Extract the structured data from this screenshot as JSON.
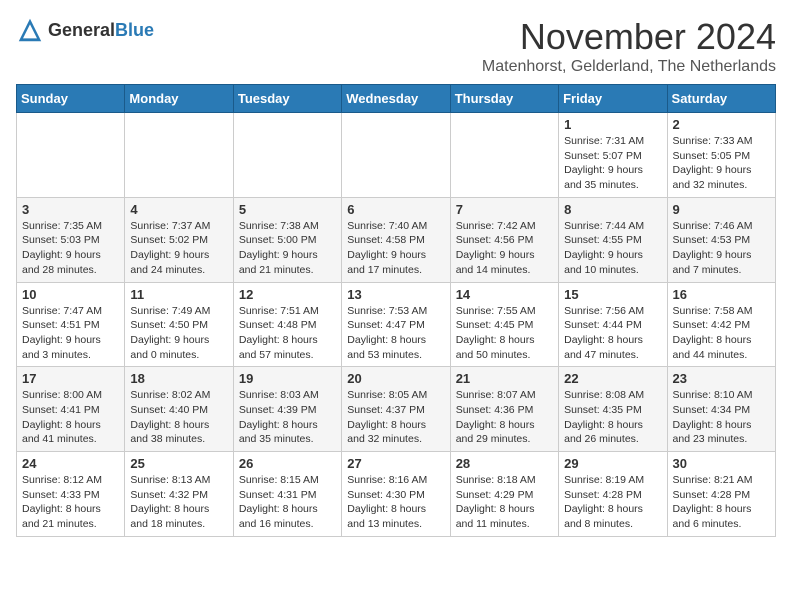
{
  "logo": {
    "text_general": "General",
    "text_blue": "Blue"
  },
  "header": {
    "month_title": "November 2024",
    "location": "Matenhorst, Gelderland, The Netherlands"
  },
  "days_of_week": [
    "Sunday",
    "Monday",
    "Tuesday",
    "Wednesday",
    "Thursday",
    "Friday",
    "Saturday"
  ],
  "weeks": [
    [
      {
        "day": "",
        "info": ""
      },
      {
        "day": "",
        "info": ""
      },
      {
        "day": "",
        "info": ""
      },
      {
        "day": "",
        "info": ""
      },
      {
        "day": "",
        "info": ""
      },
      {
        "day": "1",
        "info": "Sunrise: 7:31 AM\nSunset: 5:07 PM\nDaylight: 9 hours and 35 minutes."
      },
      {
        "day": "2",
        "info": "Sunrise: 7:33 AM\nSunset: 5:05 PM\nDaylight: 9 hours and 32 minutes."
      }
    ],
    [
      {
        "day": "3",
        "info": "Sunrise: 7:35 AM\nSunset: 5:03 PM\nDaylight: 9 hours and 28 minutes."
      },
      {
        "day": "4",
        "info": "Sunrise: 7:37 AM\nSunset: 5:02 PM\nDaylight: 9 hours and 24 minutes."
      },
      {
        "day": "5",
        "info": "Sunrise: 7:38 AM\nSunset: 5:00 PM\nDaylight: 9 hours and 21 minutes."
      },
      {
        "day": "6",
        "info": "Sunrise: 7:40 AM\nSunset: 4:58 PM\nDaylight: 9 hours and 17 minutes."
      },
      {
        "day": "7",
        "info": "Sunrise: 7:42 AM\nSunset: 4:56 PM\nDaylight: 9 hours and 14 minutes."
      },
      {
        "day": "8",
        "info": "Sunrise: 7:44 AM\nSunset: 4:55 PM\nDaylight: 9 hours and 10 minutes."
      },
      {
        "day": "9",
        "info": "Sunrise: 7:46 AM\nSunset: 4:53 PM\nDaylight: 9 hours and 7 minutes."
      }
    ],
    [
      {
        "day": "10",
        "info": "Sunrise: 7:47 AM\nSunset: 4:51 PM\nDaylight: 9 hours and 3 minutes."
      },
      {
        "day": "11",
        "info": "Sunrise: 7:49 AM\nSunset: 4:50 PM\nDaylight: 9 hours and 0 minutes."
      },
      {
        "day": "12",
        "info": "Sunrise: 7:51 AM\nSunset: 4:48 PM\nDaylight: 8 hours and 57 minutes."
      },
      {
        "day": "13",
        "info": "Sunrise: 7:53 AM\nSunset: 4:47 PM\nDaylight: 8 hours and 53 minutes."
      },
      {
        "day": "14",
        "info": "Sunrise: 7:55 AM\nSunset: 4:45 PM\nDaylight: 8 hours and 50 minutes."
      },
      {
        "day": "15",
        "info": "Sunrise: 7:56 AM\nSunset: 4:44 PM\nDaylight: 8 hours and 47 minutes."
      },
      {
        "day": "16",
        "info": "Sunrise: 7:58 AM\nSunset: 4:42 PM\nDaylight: 8 hours and 44 minutes."
      }
    ],
    [
      {
        "day": "17",
        "info": "Sunrise: 8:00 AM\nSunset: 4:41 PM\nDaylight: 8 hours and 41 minutes."
      },
      {
        "day": "18",
        "info": "Sunrise: 8:02 AM\nSunset: 4:40 PM\nDaylight: 8 hours and 38 minutes."
      },
      {
        "day": "19",
        "info": "Sunrise: 8:03 AM\nSunset: 4:39 PM\nDaylight: 8 hours and 35 minutes."
      },
      {
        "day": "20",
        "info": "Sunrise: 8:05 AM\nSunset: 4:37 PM\nDaylight: 8 hours and 32 minutes."
      },
      {
        "day": "21",
        "info": "Sunrise: 8:07 AM\nSunset: 4:36 PM\nDaylight: 8 hours and 29 minutes."
      },
      {
        "day": "22",
        "info": "Sunrise: 8:08 AM\nSunset: 4:35 PM\nDaylight: 8 hours and 26 minutes."
      },
      {
        "day": "23",
        "info": "Sunrise: 8:10 AM\nSunset: 4:34 PM\nDaylight: 8 hours and 23 minutes."
      }
    ],
    [
      {
        "day": "24",
        "info": "Sunrise: 8:12 AM\nSunset: 4:33 PM\nDaylight: 8 hours and 21 minutes."
      },
      {
        "day": "25",
        "info": "Sunrise: 8:13 AM\nSunset: 4:32 PM\nDaylight: 8 hours and 18 minutes."
      },
      {
        "day": "26",
        "info": "Sunrise: 8:15 AM\nSunset: 4:31 PM\nDaylight: 8 hours and 16 minutes."
      },
      {
        "day": "27",
        "info": "Sunrise: 8:16 AM\nSunset: 4:30 PM\nDaylight: 8 hours and 13 minutes."
      },
      {
        "day": "28",
        "info": "Sunrise: 8:18 AM\nSunset: 4:29 PM\nDaylight: 8 hours and 11 minutes."
      },
      {
        "day": "29",
        "info": "Sunrise: 8:19 AM\nSunset: 4:28 PM\nDaylight: 8 hours and 8 minutes."
      },
      {
        "day": "30",
        "info": "Sunrise: 8:21 AM\nSunset: 4:28 PM\nDaylight: 8 hours and 6 minutes."
      }
    ]
  ]
}
